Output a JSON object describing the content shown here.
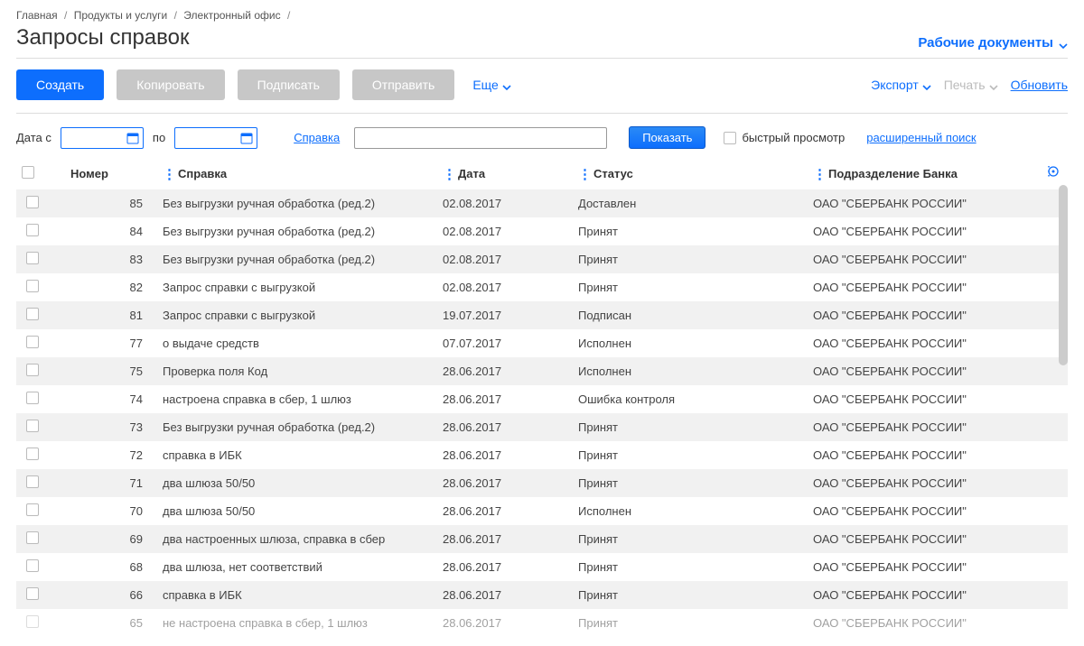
{
  "breadcrumb": {
    "home": "Главная",
    "products": "Продукты и услуги",
    "office": "Электронный офис"
  },
  "page_title": "Запросы справок",
  "workdocs": "Рабочие документы",
  "toolbar": {
    "create": "Создать",
    "copy": "Копировать",
    "sign": "Подписать",
    "send": "Отправить",
    "more": "Еще",
    "export": "Экспорт",
    "print": "Печать",
    "refresh": "Обновить"
  },
  "filter": {
    "date_from": "Дата с",
    "date_to": "по",
    "spravka": "Справка",
    "show": "Показать",
    "quick": "быстрый просмотр",
    "adv": "расширенный поиск"
  },
  "columns": {
    "number": "Номер",
    "spravka": "Справка",
    "date": "Дата",
    "status": "Статус",
    "bank": "Подразделение Банка"
  },
  "rows": [
    {
      "num": "85",
      "spr": "Без выгрузки ручная обработка (ред.2)",
      "date": "02.08.2017",
      "status": "Доставлен",
      "bank": "ОАО \"СБЕРБАНК РОССИИ\""
    },
    {
      "num": "84",
      "spr": "Без выгрузки ручная обработка (ред.2)",
      "date": "02.08.2017",
      "status": "Принят",
      "bank": "ОАО \"СБЕРБАНК РОССИИ\""
    },
    {
      "num": "83",
      "spr": "Без выгрузки ручная обработка (ред.2)",
      "date": "02.08.2017",
      "status": "Принят",
      "bank": "ОАО \"СБЕРБАНК РОССИИ\""
    },
    {
      "num": "82",
      "spr": "Запрос справки с выгрузкой",
      "date": "02.08.2017",
      "status": "Принят",
      "bank": "ОАО \"СБЕРБАНК РОССИИ\""
    },
    {
      "num": "81",
      "spr": "Запрос справки с выгрузкой",
      "date": "19.07.2017",
      "status": "Подписан",
      "bank": "ОАО \"СБЕРБАНК РОССИИ\""
    },
    {
      "num": "77",
      "spr": "о выдаче средств",
      "date": "07.07.2017",
      "status": "Исполнен",
      "bank": "ОАО \"СБЕРБАНК РОССИИ\""
    },
    {
      "num": "75",
      "spr": "Проверка поля Код",
      "date": "28.06.2017",
      "status": "Исполнен",
      "bank": "ОАО \"СБЕРБАНК РОССИИ\""
    },
    {
      "num": "74",
      "spr": "настроена справка в сбер, 1 шлюз",
      "date": "28.06.2017",
      "status": "Ошибка контроля",
      "bank": "ОАО \"СБЕРБАНК РОССИИ\""
    },
    {
      "num": "73",
      "spr": "Без выгрузки ручная обработка (ред.2)",
      "date": "28.06.2017",
      "status": "Принят",
      "bank": "ОАО \"СБЕРБАНК РОССИИ\""
    },
    {
      "num": "72",
      "spr": "справка в ИБК",
      "date": "28.06.2017",
      "status": "Принят",
      "bank": "ОАО \"СБЕРБАНК РОССИИ\""
    },
    {
      "num": "71",
      "spr": "два шлюза 50/50",
      "date": "28.06.2017",
      "status": "Принят",
      "bank": "ОАО \"СБЕРБАНК РОССИИ\""
    },
    {
      "num": "70",
      "spr": "два шлюза 50/50",
      "date": "28.06.2017",
      "status": "Исполнен",
      "bank": "ОАО \"СБЕРБАНК РОССИИ\""
    },
    {
      "num": "69",
      "spr": "два настроенных шлюза, справка в сбер",
      "date": "28.06.2017",
      "status": "Принят",
      "bank": "ОАО \"СБЕРБАНК РОССИИ\""
    },
    {
      "num": "68",
      "spr": "два шлюза, нет соответствий",
      "date": "28.06.2017",
      "status": "Принят",
      "bank": "ОАО \"СБЕРБАНК РОССИИ\""
    },
    {
      "num": "66",
      "spr": "справка в ИБК",
      "date": "28.06.2017",
      "status": "Принят",
      "bank": "ОАО \"СБЕРБАНК РОССИИ\""
    },
    {
      "num": "65",
      "spr": "не настроена справка в сбер, 1 шлюз",
      "date": "28.06.2017",
      "status": "Принят",
      "bank": "ОАО \"СБЕРБАНК РОССИИ\""
    }
  ]
}
